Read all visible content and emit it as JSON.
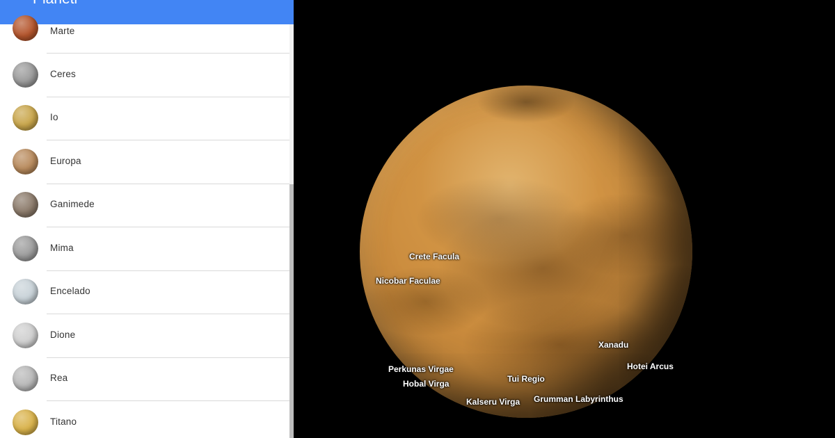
{
  "sidebar": {
    "title": "Pianeti",
    "items": [
      {
        "label": "Marte",
        "thumb": "mars-thumbnail",
        "color": "#b4552c"
      },
      {
        "label": "Ceres",
        "thumb": "ceres-thumbnail",
        "color": "#9a9a9a"
      },
      {
        "label": "Io",
        "thumb": "io-thumbnail",
        "color": "#c9a64b"
      },
      {
        "label": "Europa",
        "thumb": "europa-thumbnail",
        "color": "#b88a5c"
      },
      {
        "label": "Ganimede",
        "thumb": "ganymede-thumbnail",
        "color": "#8b7a6a"
      },
      {
        "label": "Mima",
        "thumb": "mimas-thumbnail",
        "color": "#9c9c9c"
      },
      {
        "label": "Encelado",
        "thumb": "enceladus-thumbnail",
        "color": "#c8d2d8"
      },
      {
        "label": "Dione",
        "thumb": "dione-thumbnail",
        "color": "#cfcfcf"
      },
      {
        "label": "Rea",
        "thumb": "rhea-thumbnail",
        "color": "#b8b8b8"
      },
      {
        "label": "Titano",
        "thumb": "titan-thumbnail",
        "color": "#d9b24a"
      }
    ]
  },
  "globe": {
    "body": "Titan",
    "labels": [
      {
        "text": "Crete Facula"
      },
      {
        "text": "Nicobar Faculae"
      },
      {
        "text": "Xanadu"
      },
      {
        "text": "Hotei Arcus"
      },
      {
        "text": "Perkunas Virgae"
      },
      {
        "text": "Hobal Virga"
      },
      {
        "text": "Tui Regio"
      },
      {
        "text": "Kalseru Virga"
      },
      {
        "text": "Grumman Labyrinthus"
      }
    ]
  },
  "colors": {
    "header": "#4285f4",
    "titan_surface": "#c98a3c"
  }
}
